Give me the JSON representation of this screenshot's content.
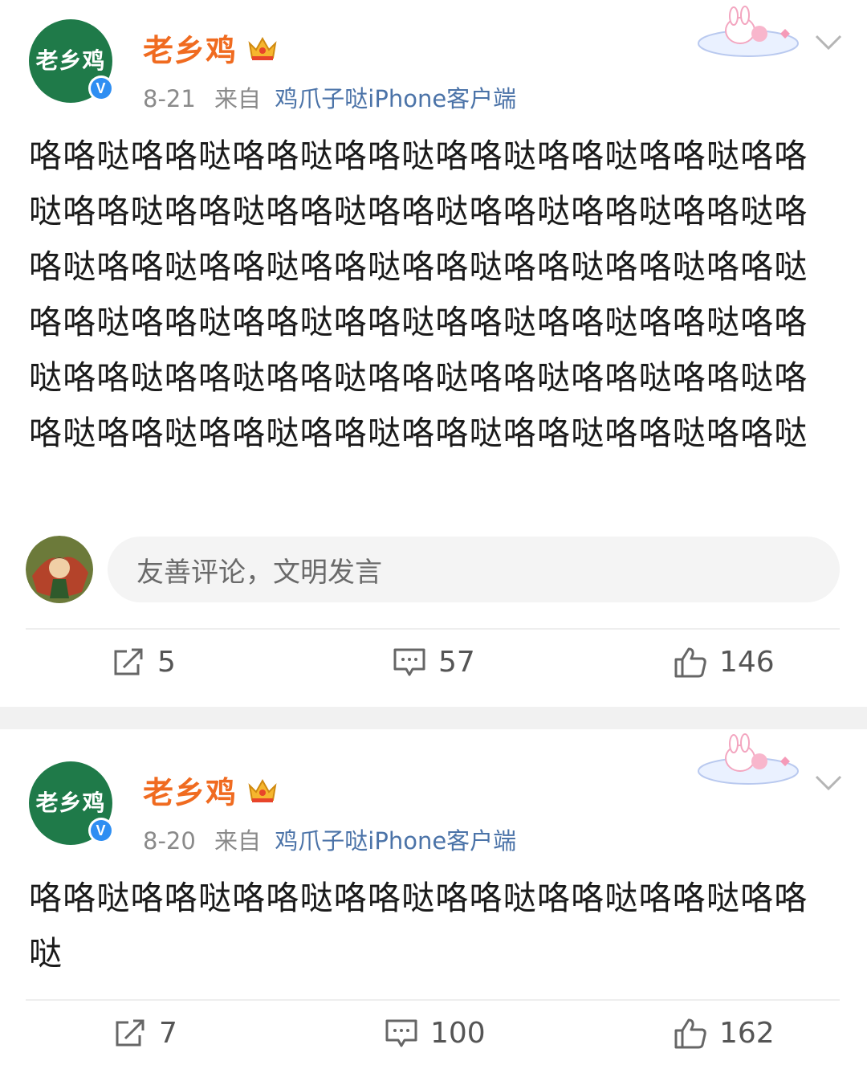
{
  "posts": [
    {
      "avatar_text": "老乡鸡",
      "verified_mark": "V",
      "author": "老乡鸡",
      "date": "8-21",
      "from_label": "来自",
      "source": "鸡爪子哒iPhone客户端",
      "content": "咯咯哒咯咯哒咯咯哒咯咯哒咯咯哒咯咯哒咯咯哒咯咯哒咯咯哒咯咯哒咯咯哒咯咯哒咯咯哒咯咯哒咯咯哒咯咯哒咯咯哒咯咯哒咯咯哒咯咯哒咯咯哒咯咯哒咯咯哒咯咯哒咯咯哒咯咯哒咯咯哒咯咯哒咯咯哒咯咯哒咯咯哒咯咯哒咯咯哒咯咯哒咯咯哒咯咯哒咯咯哒咯咯哒咯咯哒咯咯哒咯咯哒咯咯哒咯咯哒咯咯哒咯咯哒咯咯哒",
      "comment_placeholder": "友善评论，文明发言",
      "reposts": "5",
      "comments": "57",
      "likes": "146"
    },
    {
      "avatar_text": "老乡鸡",
      "verified_mark": "V",
      "author": "老乡鸡",
      "date": "8-20",
      "from_label": "来自",
      "source": "鸡爪子哒iPhone客户端",
      "content": "咯咯哒咯咯哒咯咯哒咯咯哒咯咯哒咯咯哒咯咯哒咯咯哒",
      "reposts": "7",
      "comments": "100",
      "likes": "162"
    }
  ],
  "icons": {
    "repost": "repost-icon",
    "comment": "comment-icon",
    "like": "thumbs-up-icon",
    "crown": "crown-badge-icon",
    "more": "chevron-down-icon"
  },
  "colors": {
    "author": "#f06b20",
    "avatar_bg": "#1f7a49",
    "source_link": "#4b73a8",
    "verified": "#2e8ef2"
  }
}
